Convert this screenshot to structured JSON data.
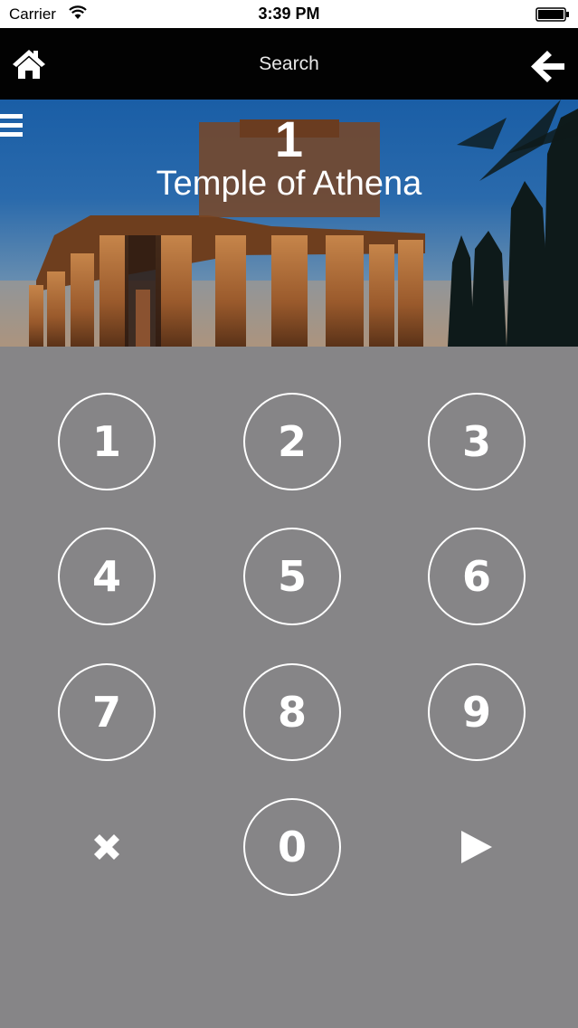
{
  "status_bar": {
    "carrier": "Carrier",
    "time": "3:39 PM"
  },
  "nav": {
    "title": "Search",
    "home_icon": "home-icon",
    "back_icon": "arrow-left-icon"
  },
  "hero": {
    "number": "1",
    "title": "Temple of Athena",
    "menu_icon": "hamburger-menu-icon"
  },
  "keypad": {
    "keys": [
      "1",
      "2",
      "3",
      "4",
      "5",
      "6",
      "7",
      "8",
      "9",
      "0"
    ],
    "clear_icon": "close-x-icon",
    "play_icon": "play-icon"
  },
  "colors": {
    "background": "#868587",
    "navbar": "#020202",
    "key_outline": "#ffffff"
  }
}
